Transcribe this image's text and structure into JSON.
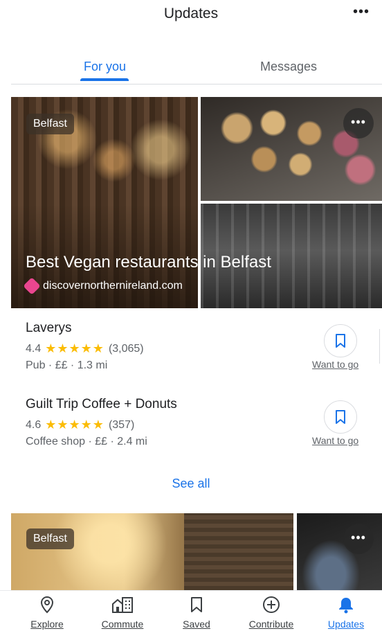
{
  "header": {
    "title": "Updates",
    "more_label": "•••"
  },
  "tabs": [
    {
      "label": "For you",
      "active": true
    },
    {
      "label": "Messages",
      "active": false
    }
  ],
  "card1": {
    "location_chip": "Belfast",
    "more_label": "•••",
    "title": "Best Vegan restaurants in Belfast",
    "source": "discovernorthernireland.com",
    "source_icon": "discover-ni-logo-icon"
  },
  "places": [
    {
      "name": "Laverys",
      "rating": "4.4",
      "rating_value": 4.4,
      "stars": "★★★★★",
      "reviews": "(3,065)",
      "meta": "Pub · ££ · 1.3 mi",
      "action_label": "Want to go",
      "action_icon": "bookmark-icon"
    },
    {
      "name": "Guilt Trip Coffee + Donuts",
      "rating": "4.6",
      "rating_value": 4.6,
      "stars": "★★★★★",
      "reviews": "(357)",
      "meta": "Coffee shop · ££ · 2.4 mi",
      "action_label": "Want to go",
      "action_icon": "bookmark-icon"
    }
  ],
  "see_all_label": "See all",
  "card2": {
    "location_chip": "Belfast",
    "more_label": "•••"
  },
  "bottom_nav": [
    {
      "label": "Explore",
      "icon": "location-pin-icon",
      "active": false
    },
    {
      "label": "Commute",
      "icon": "commute-building-icon",
      "active": false
    },
    {
      "label": "Saved",
      "icon": "bookmark-icon",
      "active": false
    },
    {
      "label": "Contribute",
      "icon": "add-circle-icon",
      "active": false
    },
    {
      "label": "Updates",
      "icon": "bell-icon",
      "active": true
    }
  ],
  "colors": {
    "accent": "#1a73e8",
    "star": "#fbbc04",
    "text_primary": "#202124",
    "text_secondary": "#5f6368",
    "source_icon": "#e9468f"
  }
}
